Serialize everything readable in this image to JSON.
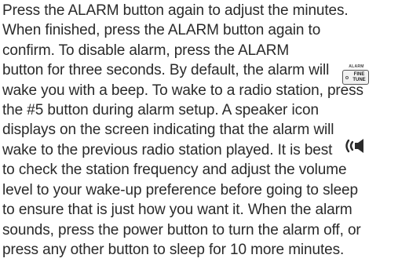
{
  "paragraph": {
    "lines": [
      [
        "Press the ALARM button again to adjust the minutes."
      ],
      [
        "When finished, press the ALARM button again to"
      ],
      [
        "confirm. To disable alarm, press the ALARM"
      ],
      [
        "button for three seconds. By default, the alarm will"
      ],
      [
        "wake you with a beep. To wake to a radio station, press"
      ],
      [
        "the #5 button during alarm setup. A speaker icon"
      ],
      [
        "displays on the screen indicating that the alarm will"
      ],
      [
        "wake to the previous radio station played. It is best"
      ],
      [
        "to check the station frequency and adjust the volume"
      ],
      [
        "level to your wake-up preference before going to sleep"
      ],
      [
        "to ensure that is just how you want it. When the alarm"
      ],
      [
        "sounds, press the power button to turn the alarm off, or"
      ],
      [
        "press any other button to sleep for 10 more minutes."
      ]
    ]
  },
  "alarm_button_icon": {
    "caption": "ALARM",
    "label_line1": "FINE",
    "label_line2": "TUNE"
  },
  "speaker_icon": {
    "icon": "speaker-icon"
  },
  "colors": {
    "text": "#2a2a2a",
    "background": "#ffffff"
  }
}
